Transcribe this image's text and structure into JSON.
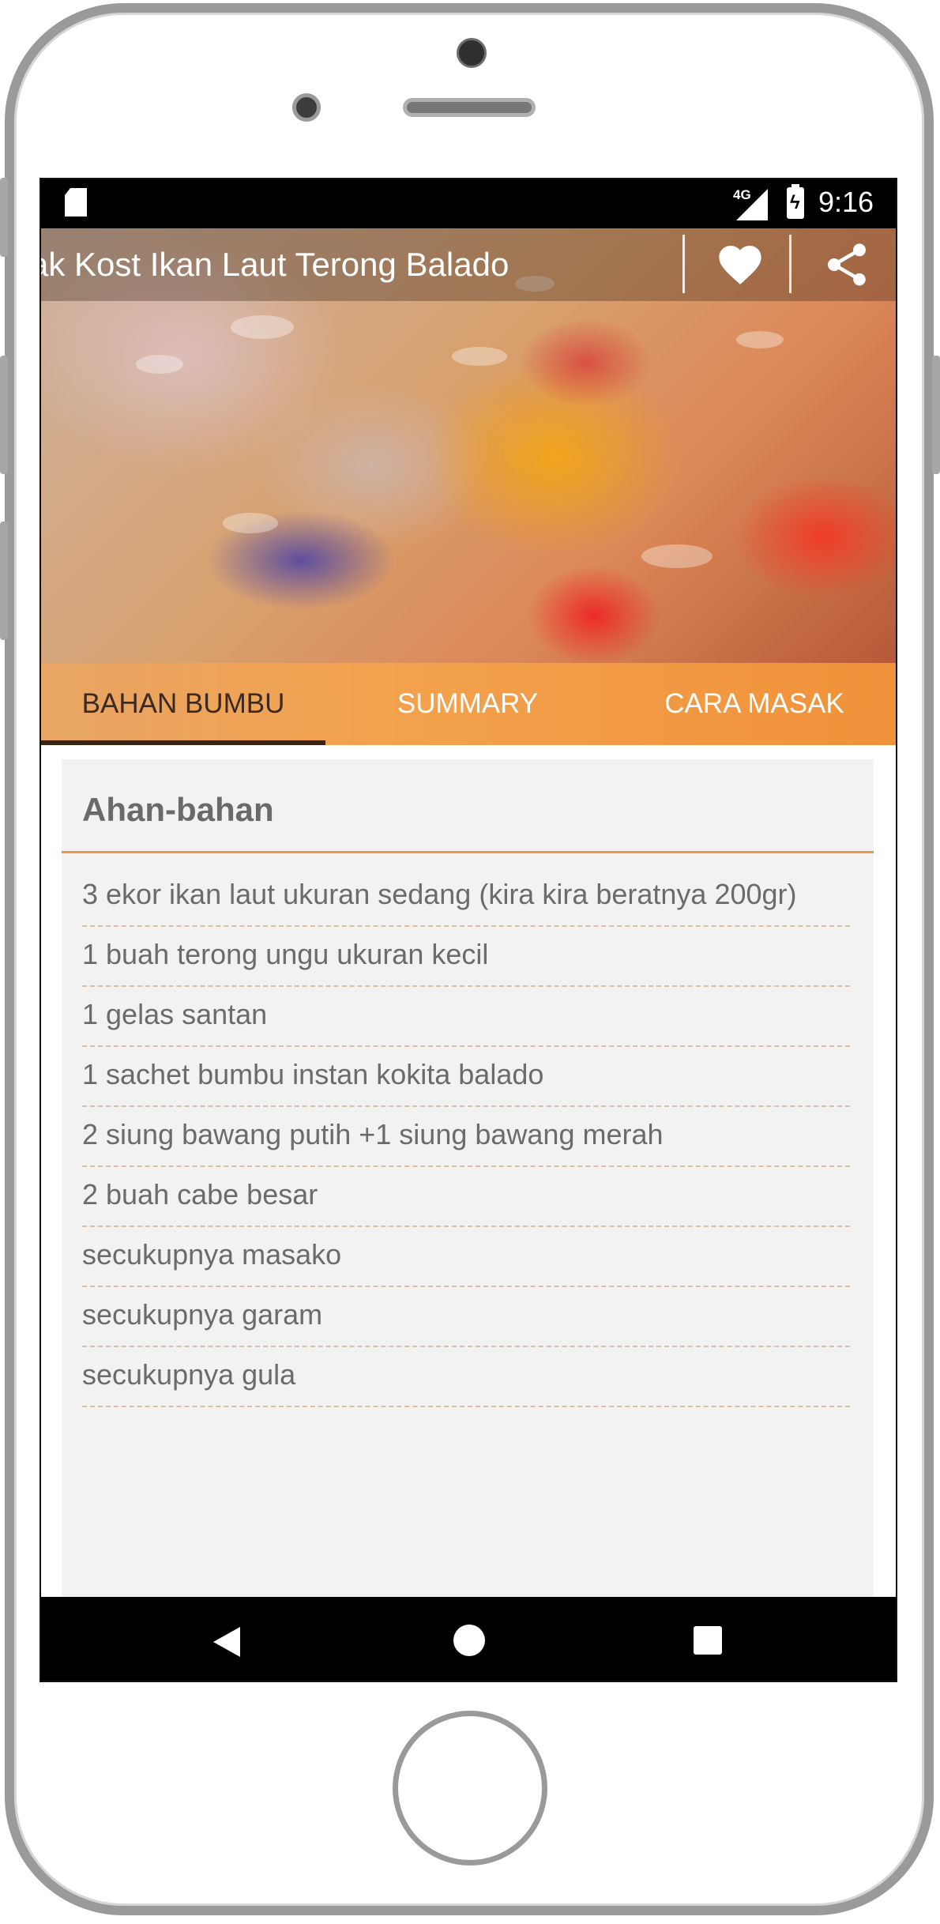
{
  "status_bar": {
    "network": "4G",
    "time": "9:16"
  },
  "app_bar": {
    "title": "ak Kost  Ikan Laut Terong Balado",
    "favorite_icon": "heart-icon",
    "share_icon": "share-icon"
  },
  "tabs": [
    {
      "label": "BAHAN BUMBU",
      "active": true
    },
    {
      "label": "SUMMARY",
      "active": false
    },
    {
      "label": "CARA MASAK",
      "active": false
    }
  ],
  "section": {
    "title": "Ahan-bahan",
    "items": [
      "3 ekor ikan laut ukuran sedang (kira kira beratnya 200gr)",
      "1 buah terong ungu ukuran kecil",
      "1 gelas santan",
      "1 sachet bumbu instan kokita balado",
      "2 siung bawang putih +1 siung bawang merah",
      "2 buah cabe besar",
      "secukupnya masako",
      "secukupnya garam",
      "secukupnya gula"
    ]
  },
  "colors": {
    "accent": "#f0a04b",
    "tab_active_text": "#3b2a20",
    "rule": "#e89a45"
  },
  "nav_bar": {
    "back_icon": "back-icon",
    "home_icon": "home-icon",
    "recents_icon": "recents-icon"
  }
}
